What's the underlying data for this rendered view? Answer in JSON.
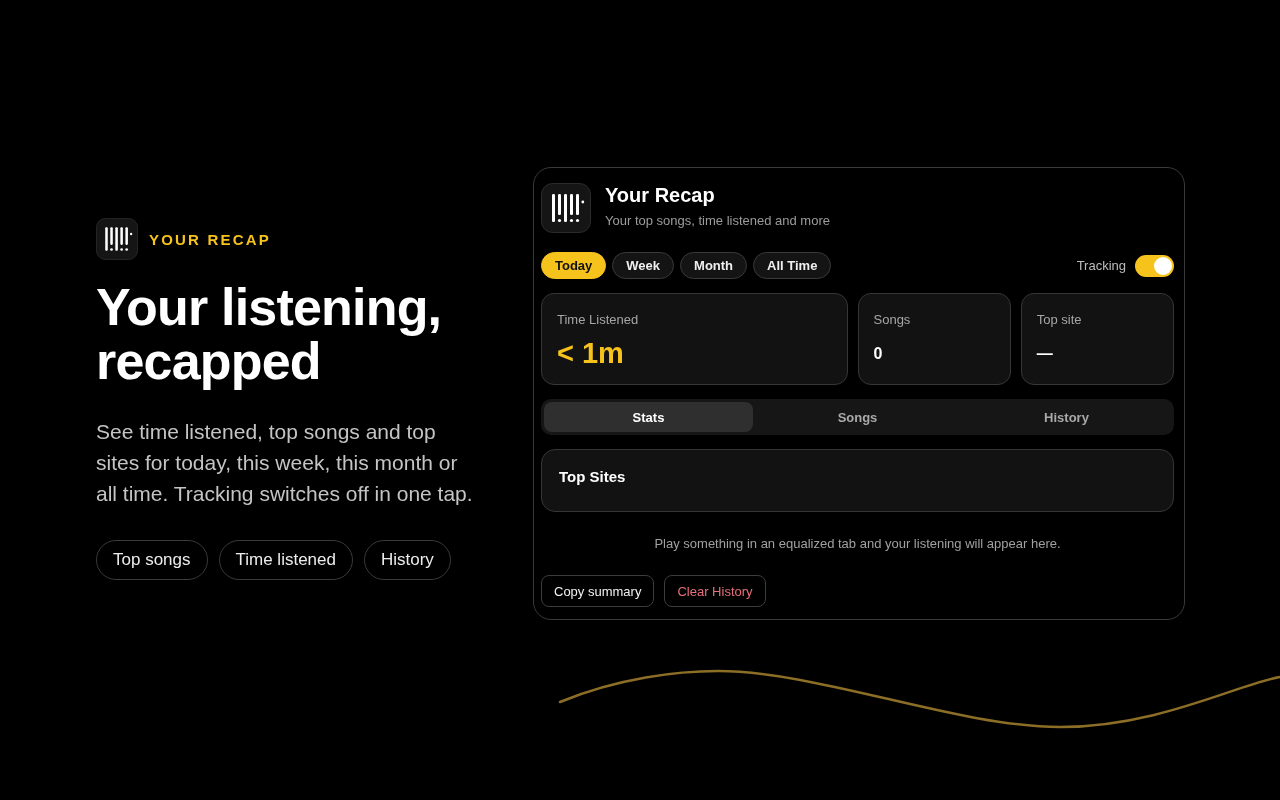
{
  "hero": {
    "eyebrow": "YOUR RECAP",
    "headline": "Your listening, recapped",
    "description": "See time listened, top songs and top sites for today, this week, this month or all time. Tracking switches off in one tap.",
    "chips": [
      "Top songs",
      "Time listened",
      "History"
    ]
  },
  "panel": {
    "title": "Your Recap",
    "subtitle": "Your top songs, time listened and more",
    "periods": [
      {
        "label": "Today",
        "selected": true
      },
      {
        "label": "Week",
        "selected": false
      },
      {
        "label": "Month",
        "selected": false
      },
      {
        "label": "All Time",
        "selected": false
      }
    ],
    "tracking": {
      "label": "Tracking",
      "on": true
    },
    "stats": [
      {
        "label": "Time Listened",
        "value": "< 1m",
        "kind": "accent"
      },
      {
        "label": "Songs",
        "value": "0",
        "kind": "plain"
      },
      {
        "label": "Top site",
        "value": "—",
        "kind": "plain"
      }
    ],
    "tabs": [
      {
        "label": "Stats",
        "selected": true
      },
      {
        "label": "Songs",
        "selected": false
      },
      {
        "label": "History",
        "selected": false
      }
    ],
    "section": {
      "title": "Top Sites"
    },
    "empty_message": "Play something in an equalized tab and your listening will appear here.",
    "buttons": [
      {
        "label": "Copy summary",
        "kind": "default"
      },
      {
        "label": "Clear History",
        "kind": "danger"
      }
    ]
  }
}
